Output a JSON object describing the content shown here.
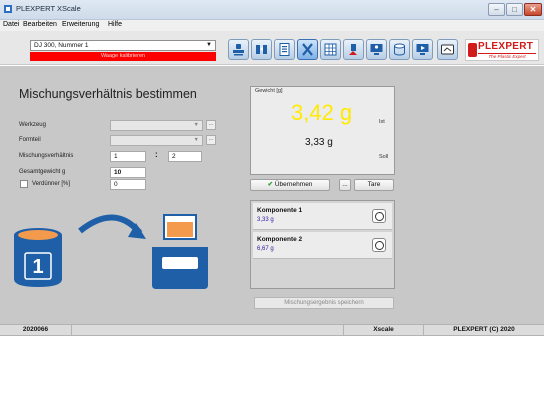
{
  "window": {
    "title": "PLEXPERT XScale",
    "controls": [
      "–",
      "□",
      "✕"
    ]
  },
  "menu": [
    "Datei",
    "Bearbeiten",
    "Erweiterung",
    "Hilfe"
  ],
  "toolbar": {
    "machine_select": "DJ 300, Nummer 1",
    "status_text": "Waage kalibrieren",
    "buttons": [
      "stamp-icon",
      "swap-icon",
      "document-icon",
      "scale-icon",
      "grid-icon",
      "calibrate-icon",
      "monitor-person-icon",
      "db-icon",
      "monitor-play-icon",
      "card-icon"
    ],
    "logo_text": "PLEXPERT",
    "logo_tagline": "The Plastic Expert"
  },
  "form": {
    "heading": "Mischungsverhältnis bestimmen",
    "tool_label": "Werkzeug",
    "tool_value": "",
    "part_label": "Formteil",
    "part_value": "",
    "ratio_label": "Mischungsverhältnis",
    "ratio_a": "1",
    "ratio_sep": ":",
    "ratio_b": "2",
    "total_label": "Gesamtgewicht g",
    "total_value": "10",
    "thinner_label": "Verdünner [%]",
    "thinner_value": "0",
    "dots": "..."
  },
  "weight": {
    "caption": "Gewicht [g]",
    "ist_value": "3,42 g",
    "ist_label": "Ist",
    "soll_value": "3,33 g",
    "soll_label": "Soll",
    "accept_label": "Übernehmen",
    "dots_label": "...",
    "tare_label": "Tare"
  },
  "components": [
    {
      "name": "Komponente 1",
      "weight": "3,33 g"
    },
    {
      "name": "Komponente 2",
      "weight": "6,67 g"
    }
  ],
  "save_label": "Mischungsergebnis speichern",
  "illustration": {
    "can_number": "1"
  },
  "statusbar": {
    "id": "2020066",
    "app": "Xscale",
    "copyright": "PLEXPERT (C) 2020"
  },
  "colors": {
    "accent_blue": "#1f5fa8",
    "ist_yellow": "#ffea00",
    "status_red": "#ff0000"
  }
}
